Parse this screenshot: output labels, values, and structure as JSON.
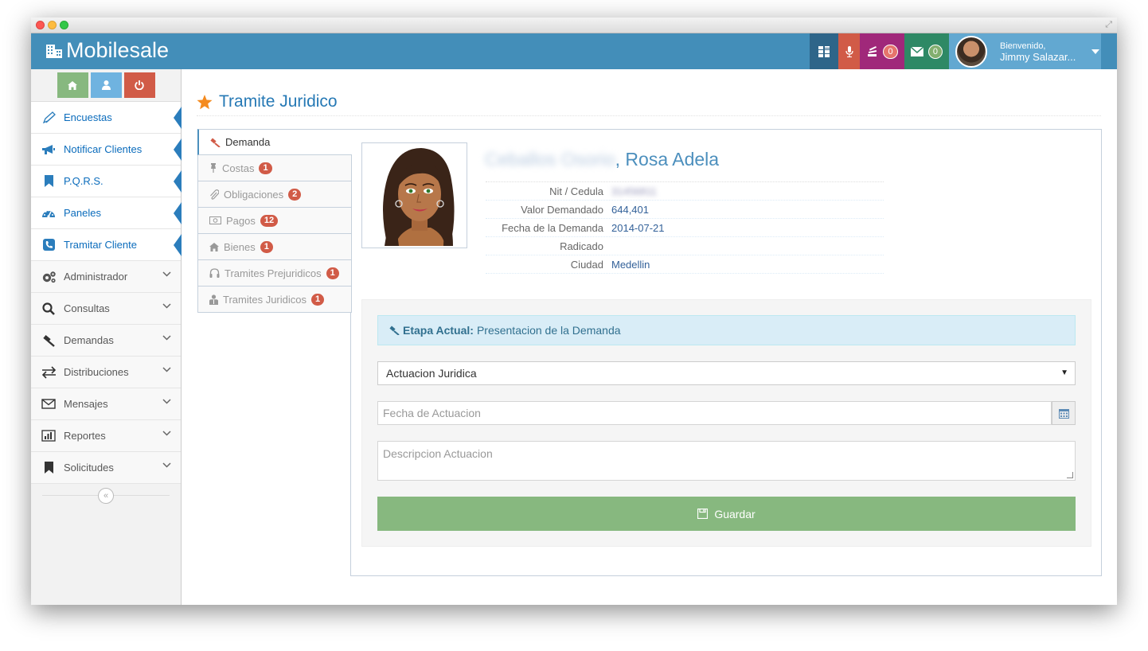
{
  "app": {
    "brand": "Mobilesale"
  },
  "navbar": {
    "notifications_count": "0",
    "messages_count": "0",
    "user": {
      "welcome": "Bienvenido,",
      "name": "Jimmy Salazar..."
    }
  },
  "sidebar": {
    "items": [
      {
        "label": "Encuestas",
        "icon": "pencil-icon"
      },
      {
        "label": "Notificar Clientes",
        "icon": "bullhorn-icon"
      },
      {
        "label": "P.Q.R.S.",
        "icon": "bookmark-icon"
      },
      {
        "label": "Paneles",
        "icon": "dashboard-icon"
      },
      {
        "label": "Tramitar Cliente",
        "icon": "phone-icon"
      },
      {
        "label": "Administrador",
        "icon": "cogs-icon"
      },
      {
        "label": "Consultas",
        "icon": "search-icon"
      },
      {
        "label": "Demandas",
        "icon": "gavel-icon"
      },
      {
        "label": "Distribuciones",
        "icon": "exchange-icon"
      },
      {
        "label": "Mensajes",
        "icon": "envelope-icon"
      },
      {
        "label": "Reportes",
        "icon": "bar-chart-icon"
      },
      {
        "label": "Solicitudes",
        "icon": "bookmark-icon"
      }
    ]
  },
  "page": {
    "title": "Tramite Juridico"
  },
  "tabs": [
    {
      "label": "Demanda",
      "badge": ""
    },
    {
      "label": "Costas",
      "badge": "1"
    },
    {
      "label": "Obligaciones",
      "badge": "2"
    },
    {
      "label": "Pagos",
      "badge": "12"
    },
    {
      "label": "Bienes",
      "badge": "1"
    },
    {
      "label": "Tramites Prejuridicos",
      "badge": "1"
    },
    {
      "label": "Tramites Juridicos",
      "badge": "1"
    }
  ],
  "profile": {
    "surname_blurred": "Ceballos Osorio",
    "given_name": ", Rosa Adela",
    "fields": [
      {
        "label": "Nit / Cedula",
        "value": "31456811"
      },
      {
        "label": "Valor Demandado",
        "value": "644,401"
      },
      {
        "label": "Fecha de la Demanda",
        "value": "2014-07-21"
      },
      {
        "label": "Radicado",
        "value": ""
      },
      {
        "label": "Ciudad",
        "value": "Medellin"
      }
    ]
  },
  "form": {
    "stage_label": "Etapa Actual:",
    "stage_value": "Presentacion de la Demanda",
    "select_value": "Actuacion Juridica",
    "date_placeholder": "Fecha de Actuacion",
    "description_placeholder": "Descripcion Actuacion",
    "save_label": "Guardar"
  },
  "colors": {
    "navbar": "#438eb9",
    "accent": "#2679b5",
    "save": "#87b87f",
    "badge": "#d15b47"
  }
}
